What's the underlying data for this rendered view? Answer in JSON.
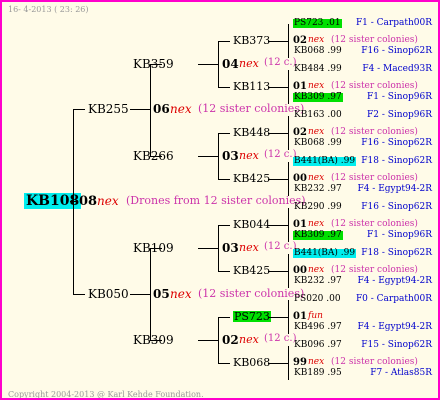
{
  "header_date": "16- 4-2013 ( 23: 26)",
  "copyright": "Copyright 2004-2013 @ Karl Kehde Foundation.",
  "root": {
    "name": "KB108",
    "gen_num": "08",
    "nex": "nex",
    "note": "(Drones from 12 sister colonies)"
  },
  "p1": {
    "name": "KB255",
    "gen_num": "06",
    "nex": "nex",
    "note": "(12 sister colonies)"
  },
  "p2": {
    "name": "KB050",
    "gen_num": "05",
    "nex": "nex",
    "note": "(12 sister colonies)"
  },
  "g1": {
    "name": "KB359",
    "gen_num": "04",
    "nex": "nex",
    "note": "(12 c.)"
  },
  "g2": {
    "name": "KB266",
    "gen_num": "03",
    "nex": "nex",
    "note": "(12 c.)"
  },
  "g3": {
    "name": "KB109",
    "gen_num": "03",
    "nex": "nex",
    "note": "(12 c.)"
  },
  "g4": {
    "name": "KB309",
    "gen_num": "02",
    "nex": "nex",
    "note": "(12 c.)"
  },
  "gg": [
    {
      "name": "KB373",
      "gen_num": "02",
      "nex": "nex",
      "note": "(12 sister colonies)"
    },
    {
      "name": "KB113",
      "gen_num": "01",
      "nex": "nex",
      "note": "(12 sister colonies)"
    },
    {
      "name": "KB448",
      "gen_num": "02",
      "nex": "nex",
      "note": "(12 sister colonies)"
    },
    {
      "name": "KB425",
      "gen_num": "00",
      "nex": "nex",
      "note": "(12 sister colonies)"
    },
    {
      "name": "KB044",
      "gen_num": "01",
      "nex": "nex",
      "note": "(12 sister colonies)"
    },
    {
      "name": "KB425",
      "gen_num": "00",
      "nex": "nex",
      "note": "(12 sister colonies)"
    },
    {
      "name": "PS723",
      "gen_num": "01",
      "nex": "fun",
      "note": ""
    },
    {
      "name": "KB068",
      "gen_num": "99",
      "nex": "nex",
      "note": "(12 sister colonies)"
    }
  ],
  "right": [
    {
      "id": "PS723 .01",
      "code": "F1 - Carpath00R",
      "hl": "green"
    },
    {
      "id": "KB068 .99",
      "code": "F16 - Sinop62R",
      "hl": ""
    },
    {
      "id": "KB484 .99",
      "code": "F4 - Maced93R",
      "hl": ""
    },
    {
      "id": "KB309 .97",
      "code": "F1 - Sinop96R",
      "hl": "green"
    },
    {
      "id": "KB163 .00",
      "code": "F2 - Sinop96R",
      "hl": ""
    },
    {
      "id": "KB068 .99",
      "code": "F16 - Sinop62R",
      "hl": ""
    },
    {
      "id": "B441(BA) .99",
      "code": "F18 - Sinop62R",
      "hl": "cyan"
    },
    {
      "id": "KB232 .97",
      "code": "F4 - Egypt94-2R",
      "hl": ""
    },
    {
      "id": "KB290 .99",
      "code": "F16 - Sinop62R",
      "hl": ""
    },
    {
      "id": "KB309 .97",
      "code": "F1 - Sinop96R",
      "hl": "green"
    },
    {
      "id": "B441(BA) .99",
      "code": "F18 - Sinop62R",
      "hl": "cyan"
    },
    {
      "id": "KB232 .97",
      "code": "F4 - Egypt94-2R",
      "hl": ""
    },
    {
      "id": "PS020 .00",
      "code": "F0 - Carpath00R",
      "hl": ""
    },
    {
      "id": "KB496 .97",
      "code": "F4 - Egypt94-2R",
      "hl": ""
    },
    {
      "id": "KB096 .97",
      "code": "F15 - Sinop62R",
      "hl": ""
    },
    {
      "id": "KB189 .95",
      "code": "F7 - Atlas85R",
      "hl": ""
    }
  ]
}
